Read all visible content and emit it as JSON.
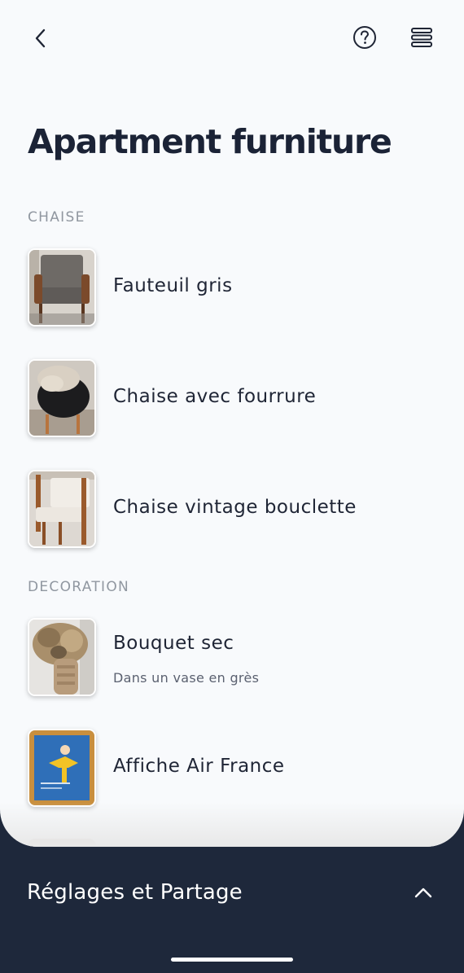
{
  "header": {
    "back_icon": "chevron-left-icon",
    "help_icon": "question-circle-icon",
    "menu_icon": "stack-menu-icon"
  },
  "page_title": "Apartment furniture",
  "sections": [
    {
      "label": "CHAISE",
      "items": [
        {
          "title": "Fauteuil gris",
          "subtitle": "",
          "thumb": "grey-armchair-photo"
        },
        {
          "title": "Chaise avec fourrure",
          "subtitle": "",
          "thumb": "fur-chair-photo"
        },
        {
          "title": "Chaise vintage bouclette",
          "subtitle": "",
          "thumb": "vintage-chair-photo"
        }
      ]
    },
    {
      "label": "DECORATION",
      "items": [
        {
          "title": "Bouquet sec",
          "subtitle": "Dans un vase en grès",
          "thumb": "dried-bouquet-photo"
        },
        {
          "title": "Affiche Air France",
          "subtitle": "",
          "thumb": "air-france-poster-photo"
        }
      ]
    }
  ],
  "bottom_panel": {
    "title": "Réglages et Partage",
    "toggle_icon": "chevron-up-icon"
  },
  "colors": {
    "background": "#f8fafc",
    "dark_panel": "#1e283b",
    "title_text": "#1b2336",
    "section_label": "#9097a0"
  }
}
